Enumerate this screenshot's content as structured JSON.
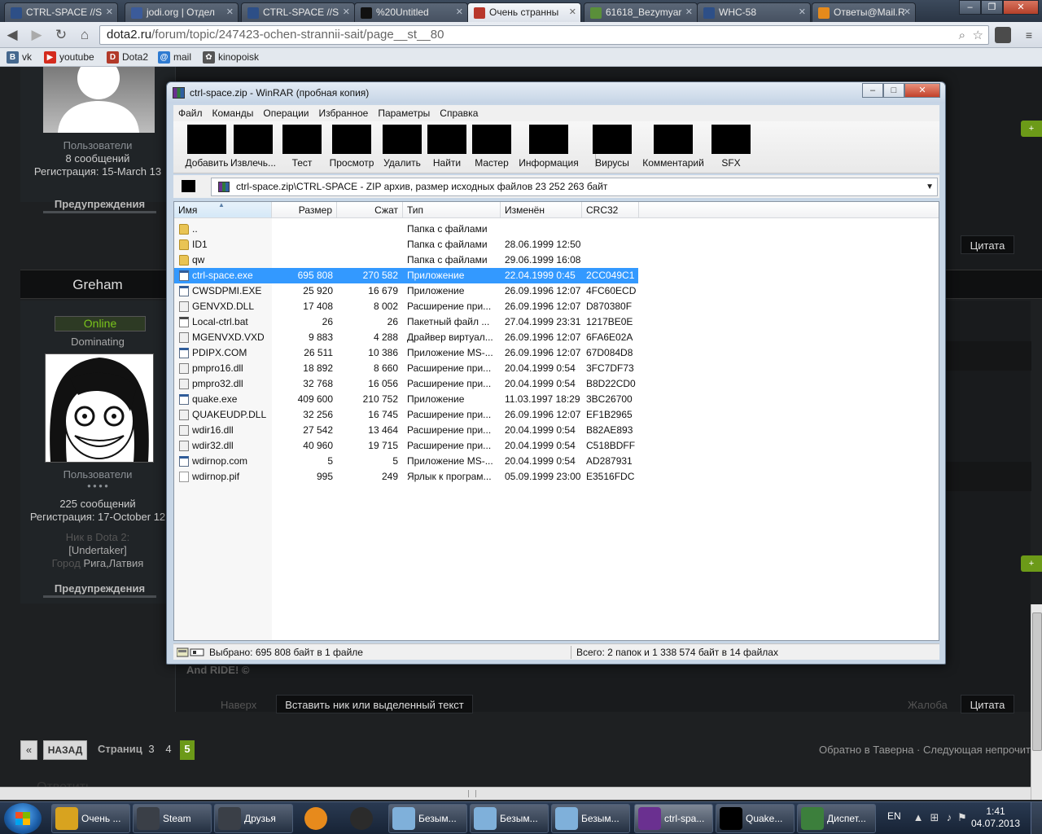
{
  "browser": {
    "tabs": [
      {
        "title": "CTRL-SPACE //S",
        "color": "#2d4f87"
      },
      {
        "title": "jodi.org | Отдел",
        "color": "#3b5b9a"
      },
      {
        "title": "CTRL-SPACE //S",
        "color": "#2d4f87"
      },
      {
        "title": "%20Untitled",
        "color": "#111111"
      },
      {
        "title": "Очень странны",
        "color": "#b8372b"
      },
      {
        "title": "61618_Bezymyar",
        "color": "#5a8f3a"
      },
      {
        "title": "WHC-58",
        "color": "#2d4f87"
      },
      {
        "title": "Ответы@Mail.R",
        "color": "#e58a1c"
      }
    ],
    "window_buttons": {
      "minimize": "–",
      "maximize": "❐",
      "close": "✕"
    },
    "nav": {
      "back": "◀",
      "forward": "▶",
      "reload": "↻",
      "home": "⌂"
    },
    "url_host": "dota2.ru",
    "url_path": "/forum/topic/247423-ochen-strannii-sait/page__st__80",
    "omnibox_icons": {
      "zoom": "⌕",
      "star": "☆"
    },
    "bookmarks": [
      {
        "label": "vk",
        "glyph": "B",
        "color": "#45688e"
      },
      {
        "label": "youtube",
        "glyph": "▶",
        "color": "#d42b1e"
      },
      {
        "label": "Dota2",
        "glyph": "D",
        "color": "#b23a2a"
      },
      {
        "label": "mail",
        "glyph": "@",
        "color": "#2f7bd1"
      },
      {
        "label": "kinopoisk",
        "glyph": "✿",
        "color": "#555555"
      }
    ]
  },
  "forum": {
    "user1": {
      "group": "Пользователи",
      "posts": "8 сообщений",
      "registered": "Регистрация: 15-March 13",
      "warnings": "Предупреждения"
    },
    "user2": {
      "name": "Greham",
      "status": "Online",
      "rank": "Dominating",
      "group": "Пользователи",
      "pips": "● ● ● ●",
      "posts": "225 сообщений",
      "registered": "Регистрация: 17-October 12",
      "nick_label": "Ник в Dota 2:",
      "nick_value": "[Undertaker]",
      "city_label": "Город",
      "city_value": "Рига,Латвия",
      "warnings": "Предупреждения"
    },
    "post_text": "And RIDE! ©",
    "up_link": "Наверх",
    "insert_button": "Вставить ник или выделенный текст",
    "report_link": "Жалоба",
    "quote_button": "Цитата",
    "quote_button_top": "Цитата",
    "pager": {
      "prev": "«",
      "back": "НАЗАД",
      "label": "Страниц",
      "pages": [
        "3",
        "4"
      ],
      "current": "5"
    },
    "breadcrumb_right": "Обратно в Таверна · Следующая непрочит",
    "reply_hint": "Ответить"
  },
  "winrar": {
    "title": "ctrl-space.zip - WinRAR (пробная копия)",
    "menu": [
      "Файл",
      "Команды",
      "Операции",
      "Избранное",
      "Параметры",
      "Справка"
    ],
    "tools": [
      "Добавить",
      "Извлечь...",
      "Тест",
      "Просмотр",
      "Удалить",
      "Найти",
      "Мастер",
      "Информация",
      "Вирусы",
      "Комментарий",
      "SFX"
    ],
    "path": "ctrl-space.zip\\CTRL-SPACE - ZIP архив, размер исходных файлов 23 252 263 байт",
    "columns": {
      "name": "Имя",
      "size": "Размер",
      "packed": "Сжат",
      "type": "Тип",
      "modified": "Изменён",
      "crc": "CRC32"
    },
    "rows": [
      {
        "name": "..",
        "size": "",
        "packed": "",
        "type": "Папка с файлами",
        "modified": "",
        "crc": "",
        "kind": "folder"
      },
      {
        "name": "ID1",
        "size": "",
        "packed": "",
        "type": "Папка с файлами",
        "modified": "28.06.1999 12:50",
        "crc": "",
        "kind": "folder"
      },
      {
        "name": "qw",
        "size": "",
        "packed": "",
        "type": "Папка с файлами",
        "modified": "29.06.1999 16:08",
        "crc": "",
        "kind": "folder"
      },
      {
        "name": "ctrl-space.exe",
        "size": "695 808",
        "packed": "270 582",
        "type": "Приложение",
        "modified": "22.04.1999 0:45",
        "crc": "2CC049C1",
        "kind": "exe",
        "selected": true
      },
      {
        "name": "CWSDPMI.EXE",
        "size": "25 920",
        "packed": "16 679",
        "type": "Приложение",
        "modified": "26.09.1996 12:07",
        "crc": "4FC60ECD",
        "kind": "exe"
      },
      {
        "name": "GENVXD.DLL",
        "size": "17 408",
        "packed": "8 002",
        "type": "Расширение при...",
        "modified": "26.09.1996 12:07",
        "crc": "D870380F",
        "kind": "dll"
      },
      {
        "name": "Local-ctrl.bat",
        "size": "26",
        "packed": "26",
        "type": "Пакетный файл ...",
        "modified": "27.04.1999 23:31",
        "crc": "1217BE0E",
        "kind": "bat"
      },
      {
        "name": "MGENVXD.VXD",
        "size": "9 883",
        "packed": "4 288",
        "type": "Драйвер виртуал...",
        "modified": "26.09.1996 12:07",
        "crc": "6FA6E02A",
        "kind": "dll"
      },
      {
        "name": "PDIPX.COM",
        "size": "26 511",
        "packed": "10 386",
        "type": "Приложение MS-...",
        "modified": "26.09.1996 12:07",
        "crc": "67D084D8",
        "kind": "exe"
      },
      {
        "name": "pmpro16.dll",
        "size": "18 892",
        "packed": "8 660",
        "type": "Расширение при...",
        "modified": "20.04.1999 0:54",
        "crc": "3FC7DF73",
        "kind": "dll"
      },
      {
        "name": "pmpro32.dll",
        "size": "32 768",
        "packed": "16 056",
        "type": "Расширение при...",
        "modified": "20.04.1999 0:54",
        "crc": "B8D22CD0",
        "kind": "dll"
      },
      {
        "name": "quake.exe",
        "size": "409 600",
        "packed": "210 752",
        "type": "Приложение",
        "modified": "11.03.1997 18:29",
        "crc": "3BC26700",
        "kind": "exe"
      },
      {
        "name": "QUAKEUDP.DLL",
        "size": "32 256",
        "packed": "16 745",
        "type": "Расширение при...",
        "modified": "26.09.1996 12:07",
        "crc": "EF1B2965",
        "kind": "dll"
      },
      {
        "name": "wdir16.dll",
        "size": "27 542",
        "packed": "13 464",
        "type": "Расширение при...",
        "modified": "20.04.1999 0:54",
        "crc": "B82AE893",
        "kind": "dll"
      },
      {
        "name": "wdir32.dll",
        "size": "40 960",
        "packed": "19 715",
        "type": "Расширение при...",
        "modified": "20.04.1999 0:54",
        "crc": "C518BDFF",
        "kind": "dll"
      },
      {
        "name": "wdirnop.com",
        "size": "5",
        "packed": "5",
        "type": "Приложение MS-...",
        "modified": "20.04.1999 0:54",
        "crc": "AD287931",
        "kind": "exe"
      },
      {
        "name": "wdirnop.pif",
        "size": "995",
        "packed": "249",
        "type": "Ярлык к програм...",
        "modified": "05.09.1999 23:00",
        "crc": "E3516FDC",
        "kind": "pif"
      }
    ],
    "status_left": "Выбрано: 695 808 байт в 1 файле",
    "status_right": "Всего: 2 папок и 1 338 574 байт в 14 файлах"
  },
  "taskbar": {
    "buttons": [
      {
        "label": "Очень ...",
        "color": "#d8a31f"
      },
      {
        "label": "Steam",
        "color": "#3a3f47"
      },
      {
        "label": "Друзья",
        "color": "#3a3f47"
      },
      {
        "label": "",
        "color": "#e78a1c"
      },
      {
        "label": "",
        "color": "#2b2b2b"
      },
      {
        "label": "Безым...",
        "color": "#7fb0da"
      },
      {
        "label": "Безым...",
        "color": "#7fb0da"
      },
      {
        "label": "Безым...",
        "color": "#7fb0da"
      },
      {
        "label": "ctrl-spa...",
        "color": "#6a3090"
      },
      {
        "label": "Quake...",
        "color": "#000000"
      },
      {
        "label": "Диспет...",
        "color": "#3c7f3c"
      }
    ],
    "lang": "EN",
    "tray_icons": {
      "up": "▲",
      "network": "⊞",
      "volume": "♪",
      "flag": "⚑"
    },
    "time": "1:41",
    "date": "04.07.2013"
  }
}
